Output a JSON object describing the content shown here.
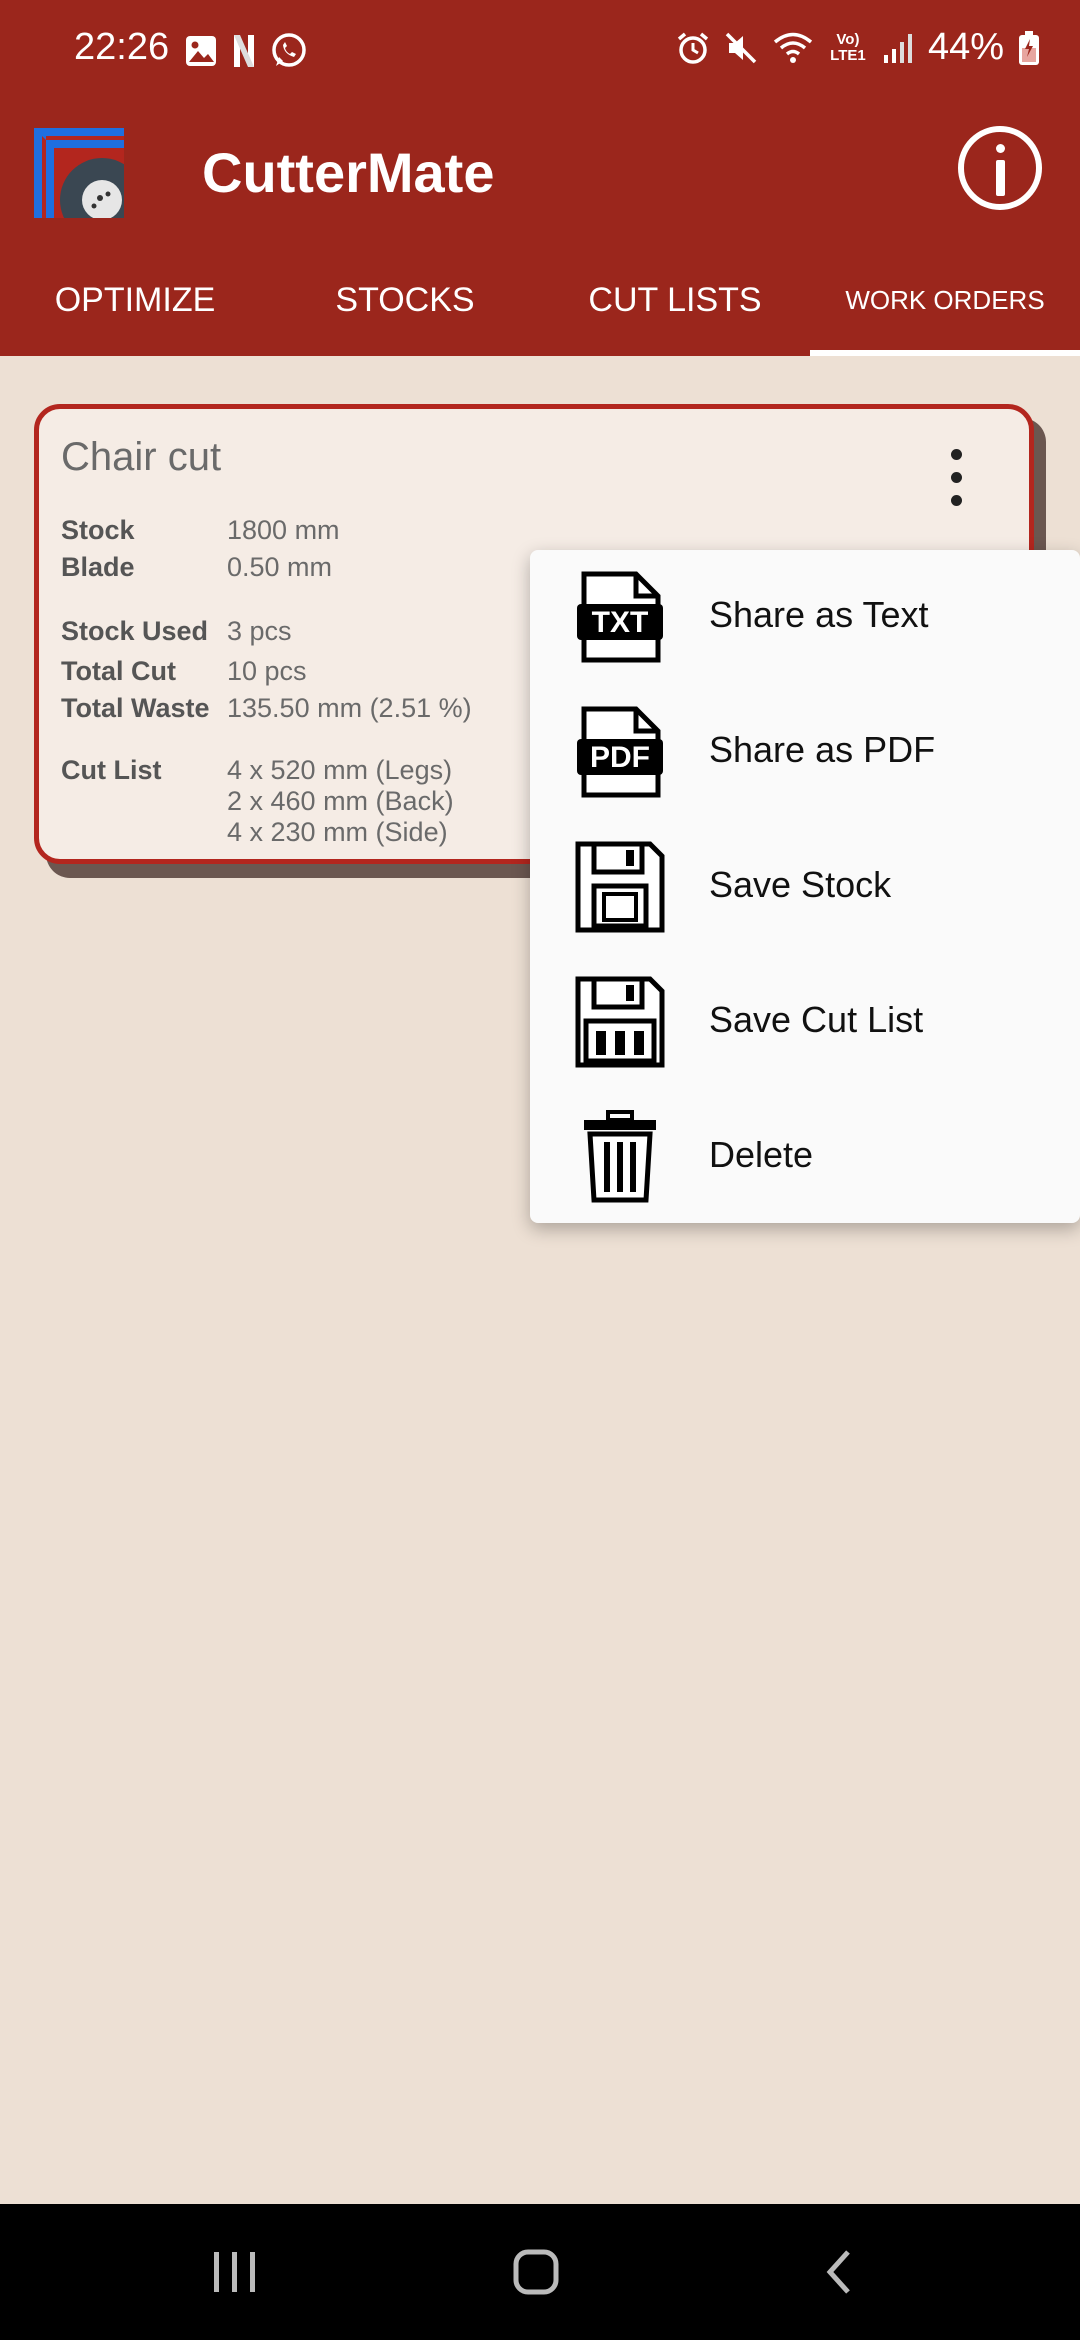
{
  "status": {
    "time": "22:26",
    "battery": "44%",
    "left_icons": [
      "image-icon",
      "netflix-icon",
      "whatsapp-icon"
    ],
    "right_icons": [
      "alarm-icon",
      "mute-icon",
      "wifi-icon",
      "volte-icon",
      "signal-icon",
      "battery-icon"
    ],
    "volte_text": "Vo) LTE1"
  },
  "app": {
    "title": "CutterMate"
  },
  "tabs": [
    {
      "label": "OPTIMIZE"
    },
    {
      "label": "STOCKS"
    },
    {
      "label": "CUT LISTS"
    },
    {
      "label": "WORK ORDERS",
      "selected": true
    }
  ],
  "card": {
    "title": "Chair cut",
    "stock_label": "Stock",
    "stock_value": "1800 mm",
    "blade_label": "Blade",
    "blade_value": "0.50 mm",
    "stock_used_label": "Stock Used",
    "stock_used_value": "3 pcs",
    "total_cut_label": "Total Cut",
    "total_cut_value": "10 pcs",
    "total_waste_label": "Total Waste",
    "total_waste_value": "135.50 mm (2.51 %)",
    "cut_list_label": "Cut List",
    "cut_list": [
      "4 x 520 mm (Legs)",
      "2 x 460 mm (Back)",
      "4 x 230 mm (Side)"
    ]
  },
  "menu": {
    "items": [
      {
        "label": "Share as Text",
        "icon": "txt-file-icon",
        "icon_text": "TXT"
      },
      {
        "label": "Share as PDF",
        "icon": "pdf-file-icon",
        "icon_text": "PDF"
      },
      {
        "label": "Save Stock",
        "icon": "floppy-disk-icon"
      },
      {
        "label": "Save Cut List",
        "icon": "floppy-list-icon"
      },
      {
        "label": "Delete",
        "icon": "trash-icon"
      }
    ]
  },
  "colors": {
    "primary": "#9b261c",
    "background": "#ede0d4",
    "card_border": "#b3261e",
    "card_bg": "#f5ece5"
  }
}
